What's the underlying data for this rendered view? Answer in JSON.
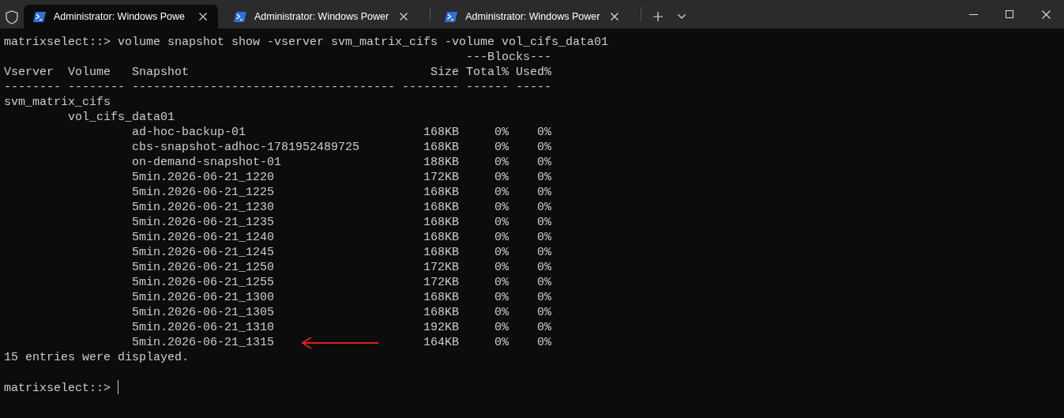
{
  "window": {
    "tabs": [
      {
        "title": "Administrator: Windows Powe",
        "selected": true
      },
      {
        "title": "Administrator: Windows Power",
        "selected": false
      },
      {
        "title": "Administrator: Windows Power",
        "selected": false
      }
    ]
  },
  "terminal": {
    "command": "matrixselect::> volume snapshot show -vserver svm_matrix_cifs -volume vol_cifs_data01",
    "group_header": "---Blocks---",
    "columns": [
      "Vserver",
      "Volume",
      "Snapshot",
      "Size",
      "Total%",
      "Used%"
    ],
    "rules": [
      "--------",
      "--------",
      "-------------------------------------",
      "--------",
      "------",
      "-----"
    ],
    "vserver": "svm_matrix_cifs",
    "volume": "vol_cifs_data01",
    "snapshots": [
      {
        "name": "ad-hoc-backup-01",
        "size": "168KB",
        "total": "0%",
        "used": "0%",
        "annotated": false
      },
      {
        "name": "cbs-snapshot-adhoc-1781952489725",
        "size": "168KB",
        "total": "0%",
        "used": "0%",
        "annotated": false
      },
      {
        "name": "on-demand-snapshot-01",
        "size": "188KB",
        "total": "0%",
        "used": "0%",
        "annotated": false
      },
      {
        "name": "5min.2026-06-21_1220",
        "size": "172KB",
        "total": "0%",
        "used": "0%",
        "annotated": false
      },
      {
        "name": "5min.2026-06-21_1225",
        "size": "168KB",
        "total": "0%",
        "used": "0%",
        "annotated": false
      },
      {
        "name": "5min.2026-06-21_1230",
        "size": "168KB",
        "total": "0%",
        "used": "0%",
        "annotated": false
      },
      {
        "name": "5min.2026-06-21_1235",
        "size": "168KB",
        "total": "0%",
        "used": "0%",
        "annotated": false
      },
      {
        "name": "5min.2026-06-21_1240",
        "size": "168KB",
        "total": "0%",
        "used": "0%",
        "annotated": false
      },
      {
        "name": "5min.2026-06-21_1245",
        "size": "168KB",
        "total": "0%",
        "used": "0%",
        "annotated": false
      },
      {
        "name": "5min.2026-06-21_1250",
        "size": "172KB",
        "total": "0%",
        "used": "0%",
        "annotated": false
      },
      {
        "name": "5min.2026-06-21_1255",
        "size": "172KB",
        "total": "0%",
        "used": "0%",
        "annotated": false
      },
      {
        "name": "5min.2026-06-21_1300",
        "size": "168KB",
        "total": "0%",
        "used": "0%",
        "annotated": false
      },
      {
        "name": "5min.2026-06-21_1305",
        "size": "168KB",
        "total": "0%",
        "used": "0%",
        "annotated": false
      },
      {
        "name": "5min.2026-06-21_1310",
        "size": "192KB",
        "total": "0%",
        "used": "0%",
        "annotated": false
      },
      {
        "name": "5min.2026-06-21_1315",
        "size": "164KB",
        "total": "0%",
        "used": "0%",
        "annotated": true
      }
    ],
    "summary": "15 entries were displayed.",
    "prompt": "matrixselect::>"
  }
}
